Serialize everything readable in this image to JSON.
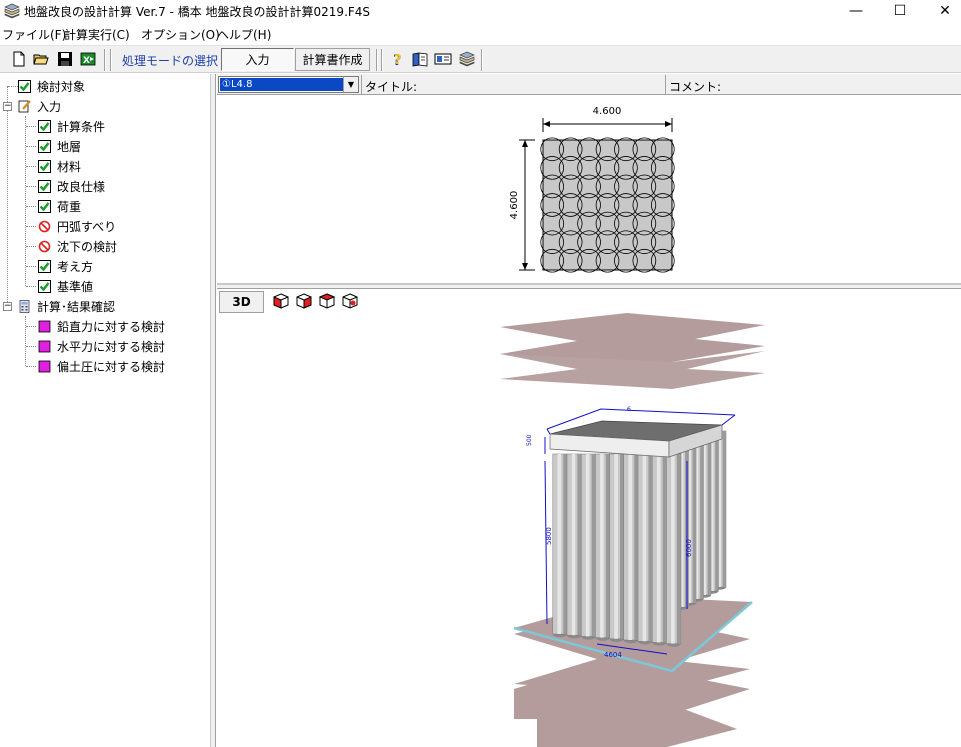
{
  "window": {
    "title": "地盤改良の設計計算  Ver.7 - 橋本 地盤改良の設計計算0219.F4S",
    "minimize_glyph": "—",
    "maximize_glyph": "☐",
    "close_glyph": "✕"
  },
  "menu": [
    {
      "label": "ファイル(F)"
    },
    {
      "label": "計算実行(C)"
    },
    {
      "label": "オプション(O)"
    },
    {
      "label": "ヘルプ(H)"
    }
  ],
  "toolbar": {
    "mode_label": "処理モードの選択",
    "input_button": "入力",
    "report_button": "計算書作成",
    "icons": [
      "new-file-icon",
      "open-folder-icon",
      "save-icon",
      "export-icon",
      "help-icon",
      "book-icon",
      "card-icon",
      "layers-icon"
    ]
  },
  "tree": {
    "items": [
      {
        "label": "検討対象",
        "icon": "green-check",
        "level": 0
      },
      {
        "label": "入力",
        "icon": "pencil-note",
        "level": 0,
        "expander": "−"
      },
      {
        "label": "計算条件",
        "icon": "green-check",
        "level": 1
      },
      {
        "label": "地層",
        "icon": "green-check",
        "level": 1
      },
      {
        "label": "材料",
        "icon": "green-check",
        "level": 1
      },
      {
        "label": "改良仕様",
        "icon": "green-check",
        "level": 1
      },
      {
        "label": "荷重",
        "icon": "green-check",
        "level": 1
      },
      {
        "label": "円弧すべり",
        "icon": "red-prohibited",
        "level": 1
      },
      {
        "label": "沈下の検討",
        "icon": "red-prohibited",
        "level": 1
      },
      {
        "label": "考え方",
        "icon": "green-check",
        "level": 1
      },
      {
        "label": "基準値",
        "icon": "green-check",
        "level": 1
      },
      {
        "label": "計算･結果確認",
        "icon": "calculator",
        "level": 0,
        "expander": "−"
      },
      {
        "label": "鉛直力に対する検討",
        "icon": "magenta-square",
        "level": 1
      },
      {
        "label": "水平力に対する検討",
        "icon": "magenta-square",
        "level": 1
      },
      {
        "label": "偏土圧に対する検討",
        "icon": "magenta-square",
        "level": 1
      }
    ]
  },
  "header": {
    "case_value": "①L4.8",
    "title_label": "タイトル:",
    "comment_label": "コメント:"
  },
  "plan": {
    "width_dim": "4.600",
    "height_dim": "4.600",
    "grid_cols": 7,
    "grid_rows": 7
  },
  "view3d": {
    "mode_button": "3D",
    "dim_top": "6",
    "dim_left_top": "500",
    "dim_depth_left": "5800",
    "dim_depth_right": "6000",
    "dim_bottom": "4604",
    "colors": {
      "layer": "#b49c9c",
      "column": "#c8c8c8",
      "slab_top": "#6e6e6e",
      "dim_line": "#1010c8",
      "base_line": "#7cc8d8"
    }
  },
  "colors": {
    "check_green": "#1a9e2a",
    "prohibited_red": "#e02020",
    "magenta": "#e020e0",
    "selection_blue": "#0a48c4",
    "mode_label_blue": "#1d3fa8"
  }
}
